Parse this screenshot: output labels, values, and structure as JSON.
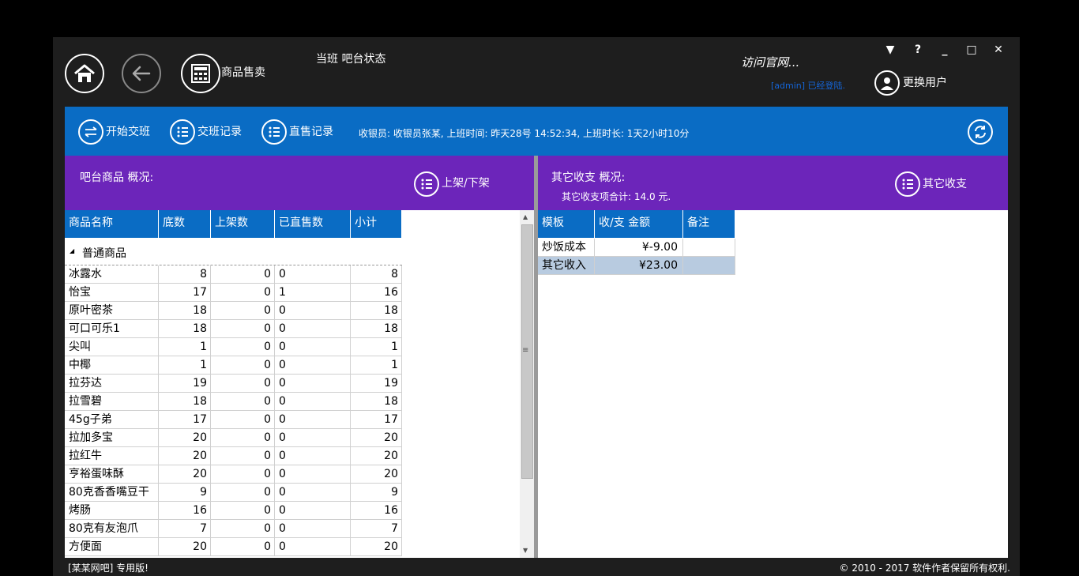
{
  "header": {
    "title": "当班  吧台状态",
    "module_label": "商品售卖",
    "visit_link": "访问官网...",
    "login_status": "[admin] 已经登陆.",
    "switch_user": "更换用户"
  },
  "window_controls": {
    "menu": "▼",
    "help": "?",
    "minimize": "_",
    "maximize": "□",
    "close": "✕"
  },
  "toolbar": {
    "start_shift": "开始交班",
    "shift_records": "交班记录",
    "direct_sale_records": "直售记录",
    "cashier_info": "收银员:  收银员张某, 上班时间: 昨天28号 14:52:34, 上班时长: 1天2小时10分"
  },
  "left_panel": {
    "title": "吧台商品  概况:",
    "shelf_button": "上架/下架",
    "columns": [
      "商品名称",
      "底数",
      "上架数",
      "已直售数",
      "小计"
    ],
    "group_name": "普通商品",
    "rows": [
      {
        "name": "冰露水",
        "base": "8",
        "shelf": "0",
        "sold": "0",
        "subtotal": "8"
      },
      {
        "name": "怡宝",
        "base": "17",
        "shelf": "0",
        "sold": "1",
        "subtotal": "16"
      },
      {
        "name": "原叶密茶",
        "base": "18",
        "shelf": "0",
        "sold": "0",
        "subtotal": "18"
      },
      {
        "name": "可口可乐1",
        "base": "18",
        "shelf": "0",
        "sold": "0",
        "subtotal": "18"
      },
      {
        "name": "尖叫",
        "base": "1",
        "shelf": "0",
        "sold": "0",
        "subtotal": "1"
      },
      {
        "name": "中椰",
        "base": "1",
        "shelf": "0",
        "sold": "0",
        "subtotal": "1"
      },
      {
        "name": "拉芬达",
        "base": "19",
        "shelf": "0",
        "sold": "0",
        "subtotal": "19"
      },
      {
        "name": "拉雪碧",
        "base": "18",
        "shelf": "0",
        "sold": "0",
        "subtotal": "18"
      },
      {
        "name": "45g子弟",
        "base": "17",
        "shelf": "0",
        "sold": "0",
        "subtotal": "17"
      },
      {
        "name": "拉加多宝",
        "base": "20",
        "shelf": "0",
        "sold": "0",
        "subtotal": "20"
      },
      {
        "name": "拉红牛",
        "base": "20",
        "shelf": "0",
        "sold": "0",
        "subtotal": "20"
      },
      {
        "name": "亨裕蛋味酥",
        "base": "20",
        "shelf": "0",
        "sold": "0",
        "subtotal": "20"
      },
      {
        "name": "80克香香嘴豆干",
        "base": "9",
        "shelf": "0",
        "sold": "0",
        "subtotal": "9"
      },
      {
        "name": "烤肠",
        "base": "16",
        "shelf": "0",
        "sold": "0",
        "subtotal": "16"
      },
      {
        "name": "80克有友泡爪",
        "base": "7",
        "shelf": "0",
        "sold": "0",
        "subtotal": "7"
      },
      {
        "name": "方便面",
        "base": "20",
        "shelf": "0",
        "sold": "0",
        "subtotal": "20"
      }
    ]
  },
  "right_panel": {
    "title": "其它收支  概况:",
    "summary": "其它收支项合计: 14.0 元.",
    "button": "其它收支",
    "columns": [
      "模板",
      "收/支 金额",
      "备注"
    ],
    "rows": [
      {
        "template": "炒饭成本",
        "amount": "¥-9.00",
        "note": ""
      },
      {
        "template": "其它收入",
        "amount": "¥23.00",
        "note": ""
      }
    ]
  },
  "footer": {
    "left": "[某某网吧] 专用版!",
    "right": "© 2010 - 2017 软件作者保留所有权利."
  },
  "colors": {
    "blue": "#0a6cc4",
    "purple": "#6c25ba",
    "selected_row": "#b8cbe0",
    "window_bg": "#1e1e1e"
  }
}
